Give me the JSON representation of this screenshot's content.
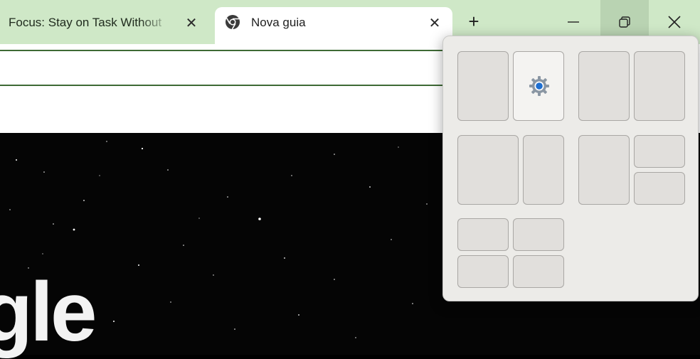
{
  "tabs": [
    {
      "title": "Focus: Stay on Task Without",
      "close_label": "✕",
      "active": false
    },
    {
      "title": "Nova guia",
      "close_label": "✕",
      "active": true
    }
  ],
  "new_tab_label": "+",
  "window_controls": {
    "minimize_icon": "minimize-icon",
    "maximize_icon": "restore-icon",
    "close_icon": "close-icon"
  },
  "page_logo_fragment": "gle",
  "snap_layouts": [
    {
      "name": "two-halves",
      "zones": 2
    },
    {
      "name": "two-halves-equal",
      "zones": 2
    },
    {
      "name": "wide-narrow",
      "zones": 2
    },
    {
      "name": "left-and-two-stacked",
      "zones": 3
    },
    {
      "name": "four-quadrants",
      "zones": 4
    }
  ],
  "colors": {
    "tabstrip": "#cfe8c7",
    "omnibox_border": "#3e6a35",
    "snap_panel": "#ecebe8",
    "focus_dot": "#1e6fd1"
  }
}
